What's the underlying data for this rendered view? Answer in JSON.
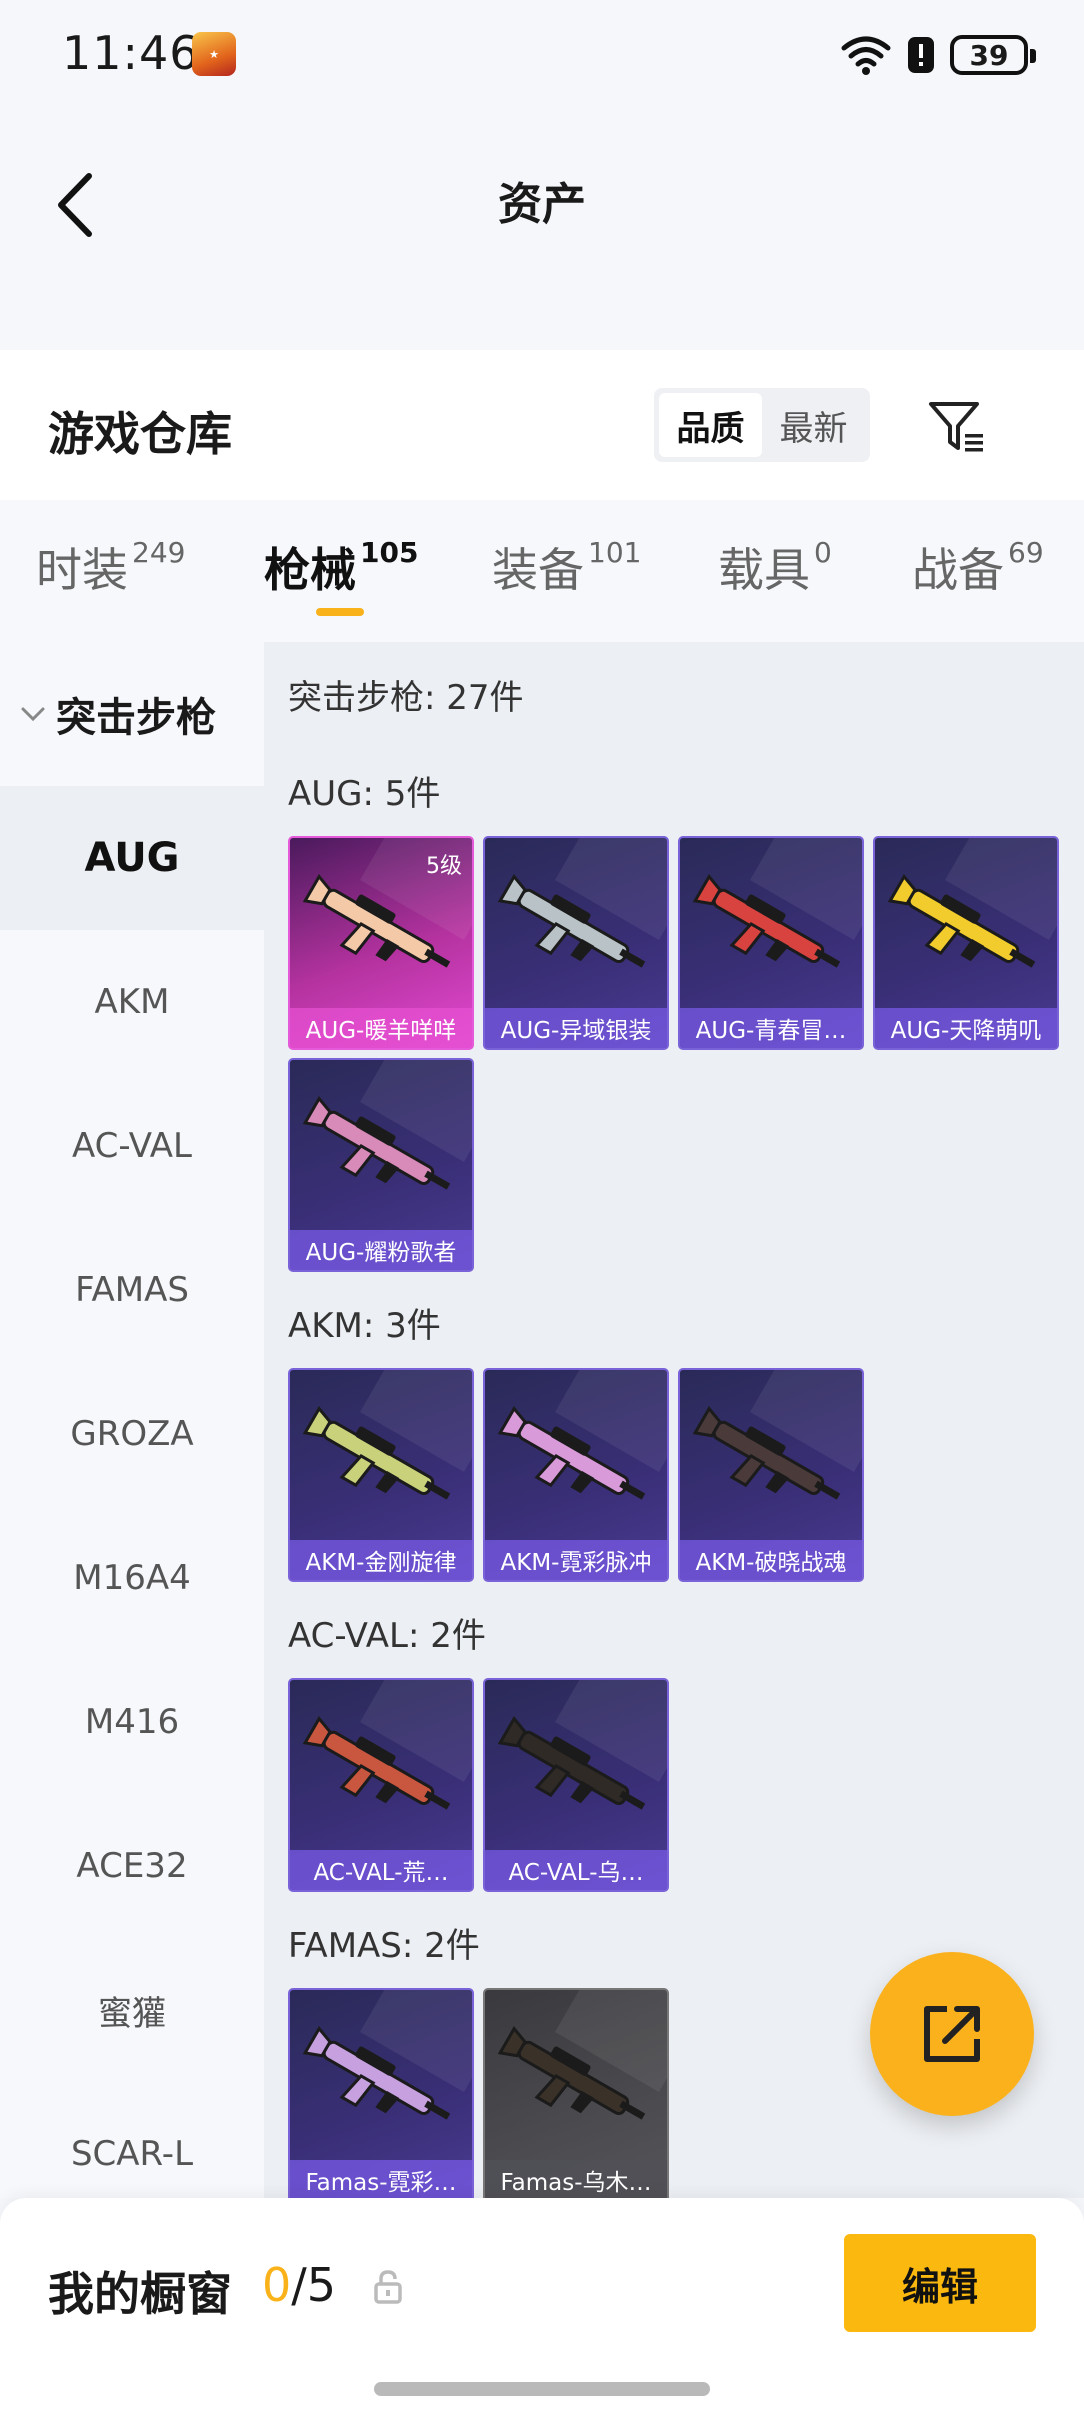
{
  "status_bar": {
    "time": "11:46",
    "battery": "39"
  },
  "header": {
    "title": "资产"
  },
  "warehouse": {
    "title": "游戏仓库",
    "sort_options": [
      "品质",
      "最新"
    ],
    "active_sort": "品质"
  },
  "tabs": [
    {
      "label": "时装",
      "count": "249"
    },
    {
      "label": "枪械",
      "count": "105"
    },
    {
      "label": "装备",
      "count": "101"
    },
    {
      "label": "载具",
      "count": "0"
    },
    {
      "label": "战备",
      "count": "69"
    }
  ],
  "active_tab": "枪械",
  "sidebar": {
    "group": "突击步枪",
    "items": [
      "AUG",
      "AKM",
      "AC-VAL",
      "FAMAS",
      "GROZA",
      "M16A4",
      "M416",
      "ACE32",
      "蜜獾",
      "SCAR-L"
    ],
    "active": "AUG"
  },
  "content": {
    "summary": "突击步枪: 27件",
    "groups": [
      {
        "title": "AUG: 5件",
        "items": [
          {
            "label": "AUG-暖羊咩咩",
            "level": "5级",
            "rarity": "pink"
          },
          {
            "label": "AUG-异域银装",
            "rarity": "purple"
          },
          {
            "label": "AUG-青春冒…",
            "rarity": "purple"
          },
          {
            "label": "AUG-天降萌叽",
            "rarity": "purple"
          },
          {
            "label": "AUG-耀粉歌者",
            "rarity": "purple"
          }
        ]
      },
      {
        "title": "AKM: 3件",
        "items": [
          {
            "label": "AKM-金刚旋律",
            "rarity": "purple"
          },
          {
            "label": "AKM-霓彩脉冲",
            "rarity": "purple"
          },
          {
            "label": "AKM-破晓战魂",
            "rarity": "purple"
          }
        ]
      },
      {
        "title": "AC-VAL: 2件",
        "items": [
          {
            "label": "AC-VAL-荒…",
            "rarity": "purple"
          },
          {
            "label": "AC-VAL-乌…",
            "rarity": "purple"
          }
        ]
      },
      {
        "title": "FAMAS: 2件",
        "items": [
          {
            "label": "Famas-霓彩…",
            "rarity": "purple"
          },
          {
            "label": "Famas-乌木…",
            "rarity": "gray"
          }
        ]
      }
    ]
  },
  "showcase": {
    "title": "我的橱窗",
    "current": "0",
    "max": "/5",
    "edit_label": "编辑"
  },
  "colors": {
    "accent": "#fbb11c",
    "rarity_purple": "#7a62d8",
    "rarity_pink": "#e45ad9"
  }
}
